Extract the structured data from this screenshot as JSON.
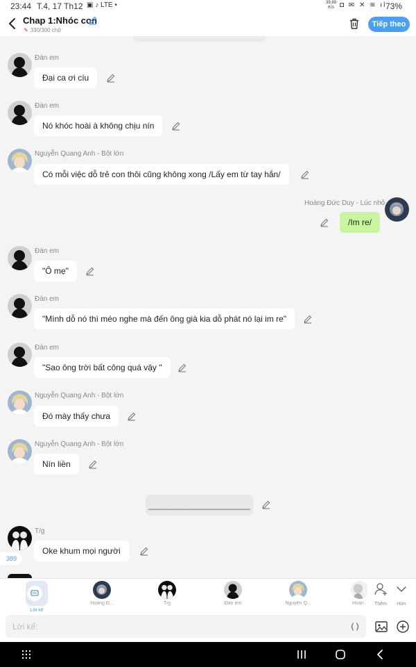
{
  "status_bar": {
    "time": "23:44",
    "date": "T.4, 17 Th12",
    "left_icons": "▣ ♪ LTE •",
    "net_speed": [
      "39,89",
      "K/s"
    ],
    "right_icons": "◘ ✉ ✕ ≋ ıl",
    "battery": "73%"
  },
  "header": {
    "title": "Chap 1:Nhóc con",
    "subtitle": "330/300 chữ",
    "next_label": "Tiếp theo"
  },
  "messages": [
    {
      "sender": "Đàn em",
      "text": "Đại ca ơi cíu",
      "side": "left",
      "avatar": "silhouette"
    },
    {
      "sender": "Đàn em",
      "text": "Nó khóc hoài à không chịu nín",
      "side": "left",
      "avatar": "silhouette"
    },
    {
      "sender": "Nguyễn Quang Anh  - Bột lớn",
      "text": "Có mỗi việc dỗ trẻ con thôi cũng không xong /Lấy em từ tay hắn/",
      "side": "left",
      "avatar": "blonde"
    },
    {
      "sender": "Hoàng Đức Duy - Lúc nhỏ",
      "text": "/Im re/",
      "side": "right",
      "avatar": "child"
    },
    {
      "sender": "Đàn em",
      "text": "\"Ô mẹ\"",
      "side": "left",
      "avatar": "silhouette"
    },
    {
      "sender": "Đàn em",
      "text": "\"Mình dỗ nó thì méo nghe mà đến ông già kia dỗ phát nó lại im re\"",
      "side": "left",
      "avatar": "silhouette"
    },
    {
      "sender": "Đàn em",
      "text": "\"Sao ông trời bất công quá vậy \"",
      "side": "left",
      "avatar": "silhouette"
    },
    {
      "sender": "Nguyễn Quang Anh  - Bột lớn",
      "text": "Đó mày thấy chưa",
      "side": "left",
      "avatar": "blonde"
    },
    {
      "sender": "Nguyễn Quang Anh  - Bột lớn",
      "text": "Nín liền",
      "side": "left",
      "avatar": "blonde"
    },
    {
      "sender": "T/g",
      "text": "Oke khum mọi người",
      "side": "left",
      "avatar": "author"
    }
  ],
  "divider_text": "______________________",
  "word_count_badge": "389",
  "characters": [
    {
      "label": "Lời kể",
      "avatar": "narration",
      "selected": true
    },
    {
      "label": "Hoàng Đ...",
      "avatar": "child",
      "selected": false
    },
    {
      "label": "T/g",
      "avatar": "author",
      "selected": false
    },
    {
      "label": "Đàn em",
      "avatar": "silhouette",
      "selected": false
    },
    {
      "label": "Nguyễn Q...",
      "avatar": "blonde",
      "selected": false
    },
    {
      "label": "Hoàn",
      "avatar": "partial",
      "selected": false
    }
  ],
  "bar_actions": {
    "add_label": "Thêm",
    "more_label": "Hơn"
  },
  "input": {
    "placeholder": "Lời kể:",
    "paren_label": "( )"
  },
  "colors": {
    "accent": "#4a9ff5",
    "my_bubble": "#c9f5a1",
    "chat_bg": "#f4f4f4"
  }
}
